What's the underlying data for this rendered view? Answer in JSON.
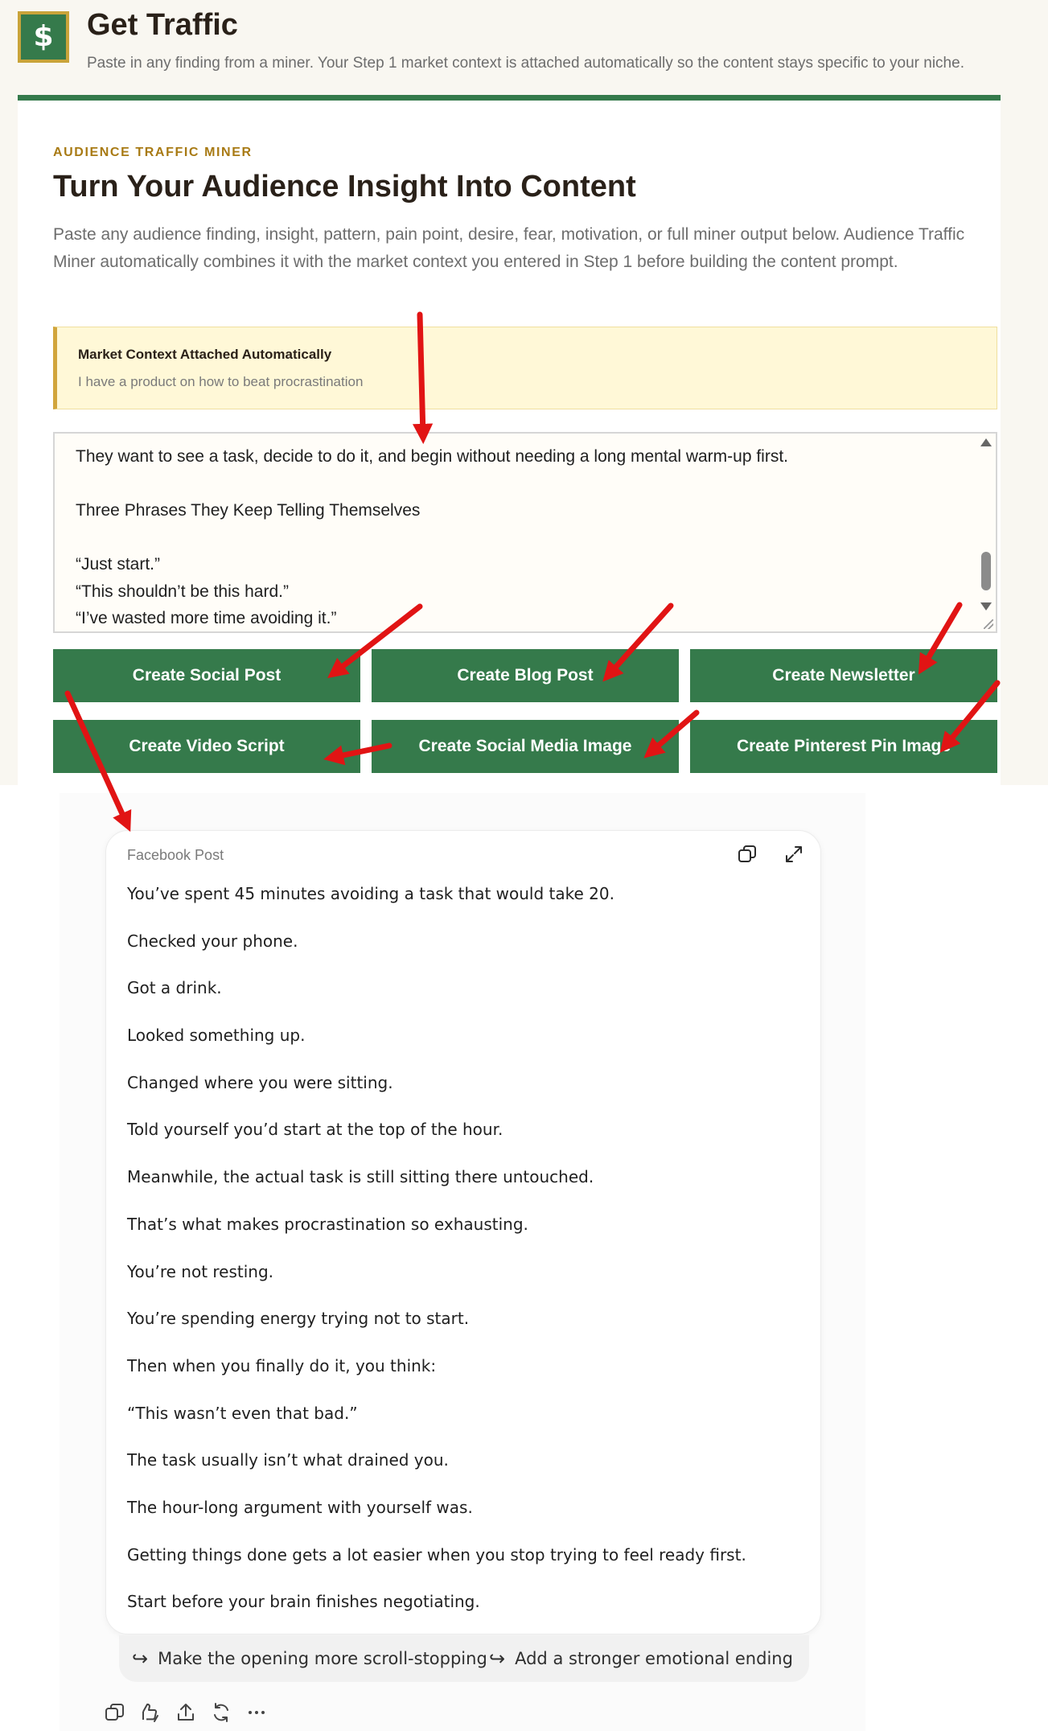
{
  "header": {
    "logo_glyph": "$",
    "title": "Get Traffic",
    "subtitle": "Paste in any finding from a miner. Your Step 1 market context is attached automatically so the content stays specific to your niche."
  },
  "card": {
    "eyebrow": "AUDIENCE TRAFFIC MINER",
    "title": "Turn Your Audience Insight Into Content",
    "description": "Paste any audience finding, insight, pattern, pain point, desire, fear, motivation, or full miner output below. Audience Traffic Miner automatically combines it with the market context you entered in Step 1 before building the content prompt.",
    "context_title": "Market Context Attached Automatically",
    "context_value": "I have a product on how to beat procrastination",
    "textarea_value": "They want to see a task, decide to do it, and begin without needing a long mental warm-up first.\n\nThree Phrases They Keep Telling Themselves\n\n“Just start.”\n“This shouldn’t be this hard.”\n“I’ve wasted more time avoiding it.”"
  },
  "buttons": {
    "social_post": "Create Social Post",
    "blog_post": "Create Blog Post",
    "newsletter": "Create Newsletter",
    "video_script": "Create Video Script",
    "social_image": "Create Social Media Image",
    "pinterest_pin": "Create Pinterest Pin Image"
  },
  "output": {
    "label": "Facebook Post",
    "lines": [
      "You’ve spent 45 minutes avoiding a task that would take 20.",
      "Checked your phone.",
      "Got a drink.",
      "Looked something up.",
      "Changed where you were sitting.",
      "Told yourself you’d start at the top of the hour.",
      "Meanwhile, the actual task is still sitting there untouched.",
      "That’s what makes procrastination so exhausting.",
      "You’re not resting.",
      "You’re spending energy trying not to start.",
      "Then when you finally do it, you think:",
      "“This wasn’t even that bad.”",
      "The task usually isn’t what drained you.",
      "The hour-long argument with yourself was.",
      "Getting things done gets a lot easier when you stop trying to feel ready first.",
      "Start before your brain finishes negotiating."
    ]
  },
  "suggestions": {
    "first": "Make the opening more scroll-stopping",
    "second": "Add a stronger emotional ending",
    "arrow_glyph": "↪"
  },
  "actions": [
    "copy-icon",
    "feedback-icon",
    "share-icon",
    "regenerate-icon",
    "more-icon"
  ],
  "colors": {
    "brand_green": "#357a4b",
    "gold": "#c9a43a",
    "eyebrow_gold": "#a87a14",
    "context_bg": "#fff8d7",
    "annotation_red": "#e11414"
  }
}
